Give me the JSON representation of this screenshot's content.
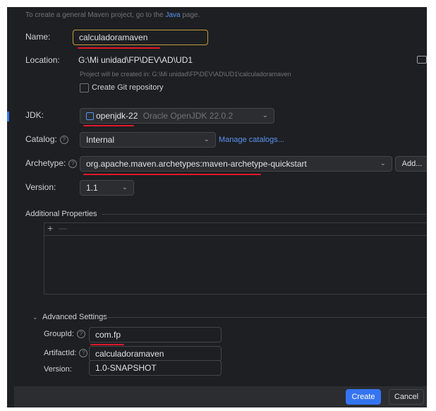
{
  "top_hint": {
    "prefix": "To create a general Maven project, go to the ",
    "link": "Java",
    "suffix": " page."
  },
  "name": {
    "label": "Name:",
    "value": "calculadoramaven"
  },
  "location": {
    "label": "Location:",
    "value": "G:\\Mi unidad\\FP\\DEV\\AD\\UD1",
    "hint": "Project will be created in: G:\\Mi unidad\\FP\\DEV\\AD\\UD1\\calculadoramaven"
  },
  "git": {
    "label": "Create Git repository",
    "checked": false
  },
  "jdk": {
    "label": "JDK:",
    "name": "openjdk-22",
    "detail": "Oracle OpenJDK 22.0.2"
  },
  "catalog": {
    "label": "Catalog:",
    "value": "Internal",
    "manage_link": "Manage catalogs..."
  },
  "archetype": {
    "label": "Archetype:",
    "value": "org.apache.maven.archetypes:maven-archetype-quickstart",
    "add_button": "Add..."
  },
  "version": {
    "label": "Version:",
    "value": "1.1"
  },
  "additional": {
    "title": "Additional Properties",
    "add": "+",
    "remove": "—"
  },
  "advanced": {
    "title": "Advanced Settings",
    "group_label": "GroupId:",
    "group_value": "com.fp",
    "artifact_label": "ArtifactId:",
    "artifact_value": "calculadoramaven",
    "version_label": "Version:",
    "version_value": "1.0-SNAPSHOT"
  },
  "buttons": {
    "create": "Create",
    "cancel": "Cancel"
  },
  "colors": {
    "accent": "#3574f0",
    "annotation": "#e0182a",
    "focus": "#c39a3a"
  }
}
